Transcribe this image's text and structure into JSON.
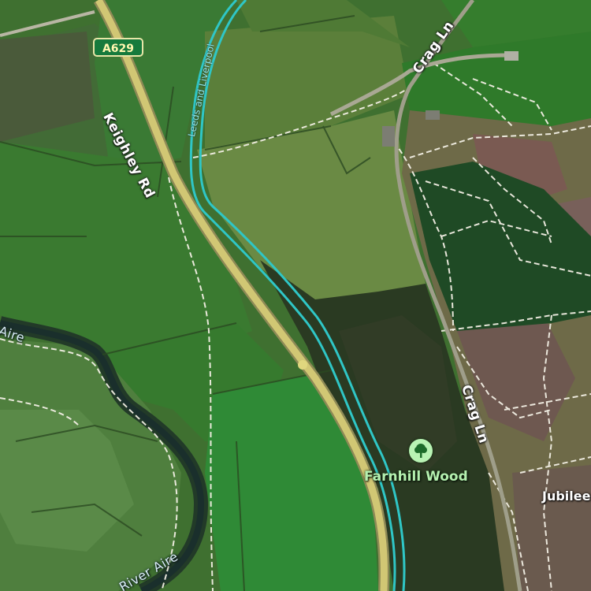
{
  "road_shield": {
    "label": "A629",
    "color": "#167a3c"
  },
  "labels": {
    "keighley_rd": "Keighley Rd",
    "crag_ln_north": "Crag Ln",
    "crag_ln_south": "Crag Ln",
    "river_aire_west": "Aire",
    "river_aire_south": "River Aire",
    "canal": "Leeds and Liverpool",
    "farnhill_wood": "Farnhill Wood",
    "jubilee": "Jubilee"
  },
  "poi": {
    "icon": "tree-icon",
    "color": "#b9f3b4"
  },
  "colors": {
    "canal": "#2fc6c6",
    "road": "#d1c774",
    "footpath": "#f2efe4",
    "water": "#1d3a3a"
  }
}
